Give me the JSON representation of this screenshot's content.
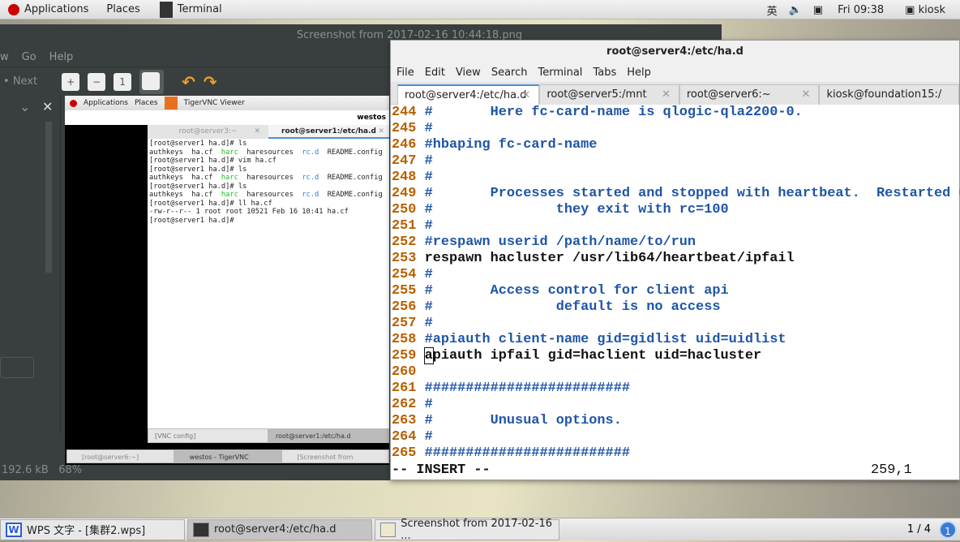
{
  "topbar": {
    "applications": "Applications",
    "places": "Places",
    "active_app": "Terminal",
    "input_method": "英",
    "clock": "Fri 09:38",
    "user": "kiosk"
  },
  "eog": {
    "title": "Screenshot from 2017-02-16 10:44:18.png",
    "menu": [
      "w",
      "Go",
      "Help"
    ],
    "next_label": "Next",
    "status_size": "192.6 kB",
    "status_zoom": "68%"
  },
  "inner": {
    "topbar": {
      "applications": "Applications",
      "places": "Places",
      "app": "TigerVNC Viewer"
    },
    "window_title": "westos",
    "vnc_tabs": [
      {
        "label": "root@server3:~"
      },
      {
        "label": "root@server1:/etc/ha.d"
      }
    ],
    "terminal_lines": [
      {
        "t": "[root@server1 ha.d]# ls"
      },
      {
        "ls": true
      },
      {
        "t": "[root@server1 ha.d]# vim ha.cf"
      },
      {
        "t": "[root@server1 ha.d]# ls"
      },
      {
        "ls": true
      },
      {
        "t": "[root@server1 ha.d]# ls"
      },
      {
        "ls": true
      },
      {
        "t": "[root@server1 ha.d]# ll ha.cf"
      },
      {
        "t": "-rw-r--r-- 1 root root 10521 Feb 16 10:41 ha.cf"
      },
      {
        "t": "[root@server1 ha.d]# "
      }
    ],
    "ls_items": {
      "a": "authkeys  ha.cf  ",
      "harc": "harc",
      "mid": "  haresources  ",
      "rcd": "rc.d",
      "end": "  README.config"
    },
    "vnc_task": [
      "[VNC config]",
      "root@server1:/etc/ha.d"
    ],
    "task": [
      "[root@server6:~]",
      "westos - TigerVNC",
      "[Screenshot from"
    ]
  },
  "terminal": {
    "title": "root@server4:/etc/ha.d",
    "menu": [
      "File",
      "Edit",
      "View",
      "Search",
      "Terminal",
      "Tabs",
      "Help"
    ],
    "tabs": [
      {
        "label": "root@server4:/etc/ha.d",
        "active": true
      },
      {
        "label": "root@server5:/mnt"
      },
      {
        "label": "root@server6:~"
      },
      {
        "label": "kiosk@foundation15:/"
      }
    ],
    "lines": [
      {
        "n": "244",
        "c": "#       Here fc-card-name is qlogic-qla2200-0."
      },
      {
        "n": "245",
        "c": "#"
      },
      {
        "n": "246",
        "c": "#hbaping fc-card-name"
      },
      {
        "n": "247",
        "c": "#"
      },
      {
        "n": "248",
        "c": "#"
      },
      {
        "n": "249",
        "c": "#       Processes started and stopped with heartbeat.  Restarted unless"
      },
      {
        "n": "250",
        "c": "#               they exit with rc=100"
      },
      {
        "n": "251",
        "c": "#"
      },
      {
        "n": "252",
        "c": "#respawn userid /path/name/to/run"
      },
      {
        "n": "253",
        "t": "respawn hacluster /usr/lib64/heartbeat/ipfail"
      },
      {
        "n": "254",
        "c": "#"
      },
      {
        "n": "255",
        "c": "#       Access control for client api"
      },
      {
        "n": "256",
        "c": "#               default is no access"
      },
      {
        "n": "257",
        "c": "#"
      },
      {
        "n": "258",
        "c": "#apiauth client-name gid=gidlist uid=uidlist"
      },
      {
        "n": "259",
        "t": "apiauth ipfail gid=haclient uid=hacluster",
        "cursor": true
      },
      {
        "n": "260",
        "t": ""
      },
      {
        "n": "261",
        "c": "#########################"
      },
      {
        "n": "262",
        "c": "#"
      },
      {
        "n": "263",
        "c": "#       Unusual options."
      },
      {
        "n": "264",
        "c": "#"
      },
      {
        "n": "265",
        "c": "#########################"
      }
    ],
    "mode": "-- INSERT --",
    "position": "259,1"
  },
  "taskbar": {
    "items": [
      {
        "label": "WPS 文字 - [集群2.wps]",
        "icon": "wps-icon"
      },
      {
        "label": "root@server4:/etc/ha.d",
        "icon": "terminal-icon",
        "active": true
      },
      {
        "label": "Screenshot from 2017-02-16 ...",
        "icon": "image-viewer-icon"
      }
    ],
    "workspace": "1 / 4",
    "workspace_badge": "1"
  },
  "colors": {
    "line_number": "#b86000",
    "comment": "#1f55a6",
    "accent": "#4a90d9"
  }
}
